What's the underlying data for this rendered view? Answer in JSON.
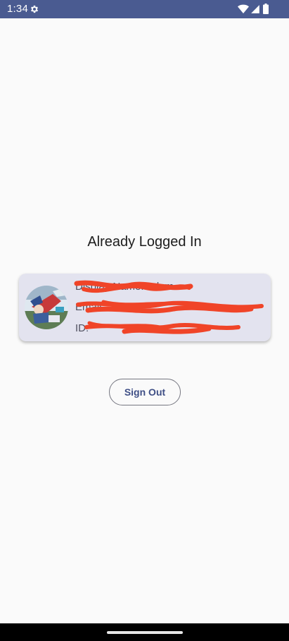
{
  "status_bar": {
    "time": "1:34",
    "icons": [
      "gear-icon",
      "wifi-icon",
      "signal-icon",
      "battery-icon"
    ],
    "background": "#4a5b91"
  },
  "title": "Already Logged In",
  "profile_card": {
    "display_name_line": "Display Name: Adam",
    "email_line": "Email: ",
    "id_line": "ID: ",
    "background": "#e3e3ef",
    "redaction_color": "#f04428"
  },
  "sign_out_button": {
    "label": "Sign Out",
    "color": "#3f4f86"
  },
  "navigation": {
    "home_indicator": "home-indicator"
  }
}
